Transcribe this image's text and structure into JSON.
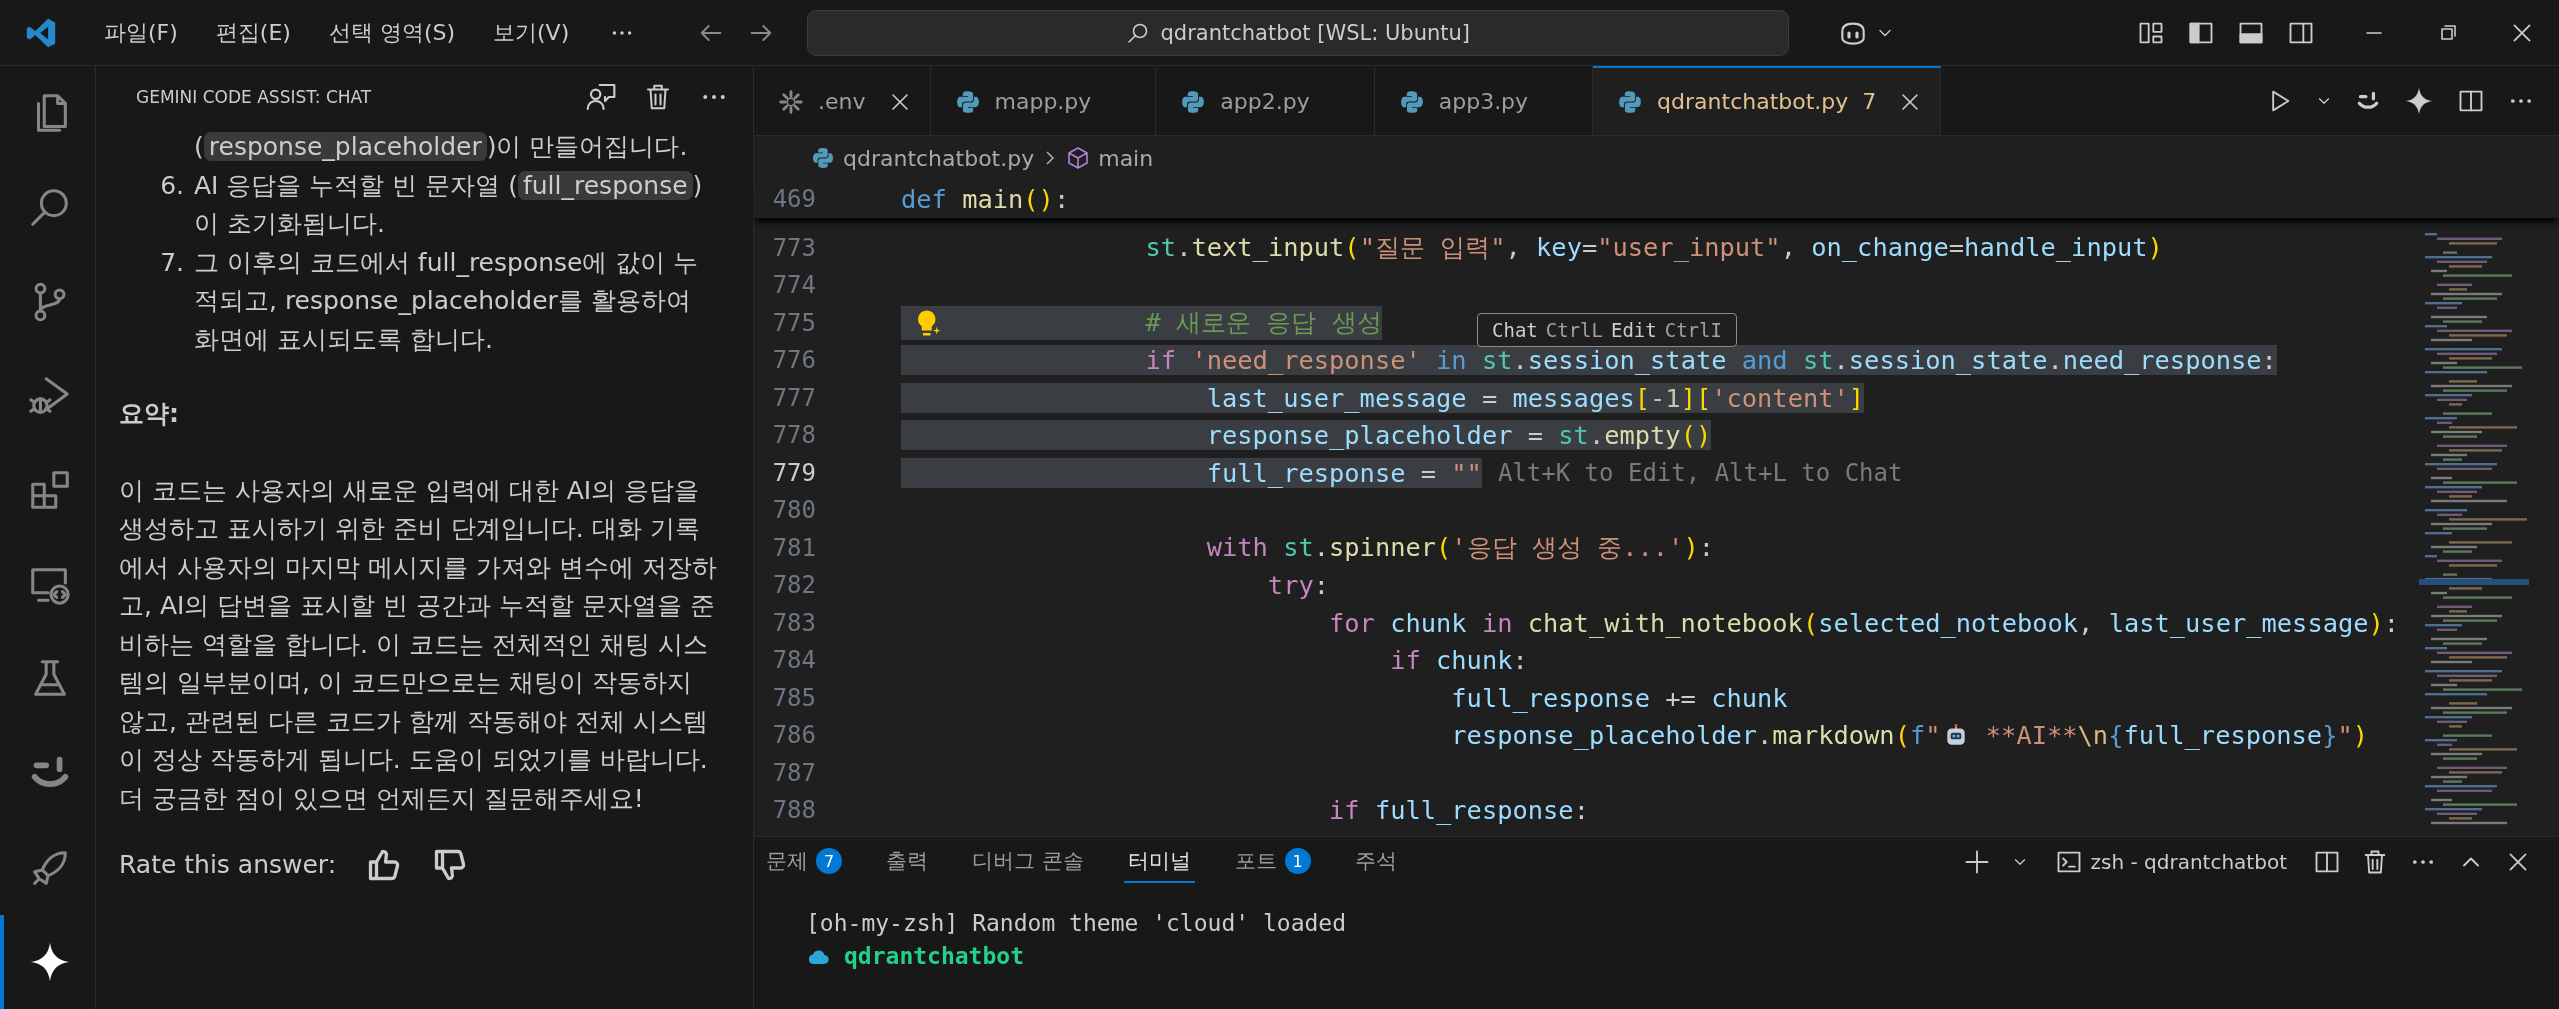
{
  "title_bar": {
    "menus": [
      {
        "label": "파일(F)"
      },
      {
        "label": "편집(E)"
      },
      {
        "label": "선택 영역(S)"
      },
      {
        "label": "보기(V)"
      }
    ],
    "command_center": "qdrantchatbot [WSL: Ubuntu]"
  },
  "activity_bar": [
    {
      "kind": "files",
      "selected": false
    },
    {
      "kind": "search",
      "selected": false
    },
    {
      "kind": "source_control",
      "selected": false
    },
    {
      "kind": "run_debug",
      "selected": false
    },
    {
      "kind": "extensions",
      "selected": false
    },
    {
      "kind": "remote",
      "selected": false
    },
    {
      "kind": "testing",
      "selected": false
    },
    {
      "kind": "smile",
      "selected": false
    },
    {
      "kind": "rocket",
      "selected": false
    },
    {
      "kind": "sparkle",
      "selected": true
    }
  ],
  "side_panel": {
    "title": "GEMINI CODE ASSIST: CHAT",
    "list": [
      {
        "parts": [
          {
            "kind": "text",
            "text": "("
          },
          {
            "kind": "code",
            "text": "response_placeholder"
          },
          {
            "kind": "text",
            "text": ")이 만들어집니다."
          }
        ]
      },
      {
        "number": "6.",
        "parts": [
          {
            "kind": "text",
            "text": "AI 응답을 누적할 빈 문자열 ("
          },
          {
            "kind": "code",
            "text": "full_response"
          },
          {
            "kind": "text",
            "text": ")이 초기화됩니다."
          }
        ]
      },
      {
        "number": "7.",
        "parts": [
          {
            "kind": "text",
            "text": "그 이후의 코드에서 full_response에 값이 누적되고, response_placeholder를 활용하여 화면에 표시되도록 합니다."
          }
        ]
      }
    ],
    "heading": "요약:",
    "paragraph": "이 코드는 사용자의 새로운 입력에 대한 AI의 응답을 생성하고 표시하기 위한 준비 단계입니다. 대화 기록에서 사용자의 마지막 메시지를 가져와 변수에 저장하고, AI의 답변을 표시할 빈 공간과 누적할 문자열을 준비하는 역할을 합니다. 이 코드는 전체적인 채팅 시스템의 일부분이며, 이 코드만으로는 채팅이 작동하지 않고, 관련된 다른 코드가 함께 작동해야 전체 시스템이 정상 작동하게 됩니다. 도움이 되었기를 바랍니다. 더 궁금한 점이 있으면 언제든지 질문해주세요!",
    "rating_label": "Rate this answer:"
  },
  "editor": {
    "tabs": [
      {
        "label": ".env",
        "kind": "config",
        "selected": false,
        "close_shown": true
      },
      {
        "label": "mapp.py",
        "kind": "python",
        "selected": false,
        "close_shown": false
      },
      {
        "label": "app2.py",
        "kind": "python",
        "selected": false,
        "close_shown": false
      },
      {
        "label": "app3.py",
        "kind": "python",
        "selected": false,
        "close_shown": false
      },
      {
        "label": "qdrantchatbot.py",
        "badge": "7",
        "kind": "python",
        "selected": true,
        "close_shown": true
      }
    ],
    "breadcrumb": [
      {
        "label": "qdrantchatbot.py",
        "kind": "file"
      },
      {
        "label": "main",
        "kind": "symbol"
      }
    ],
    "sticky_line": {
      "number": "469",
      "tokens": [
        {
          "kind": "kw",
          "text": "def "
        },
        {
          "kind": "fn",
          "text": "main"
        },
        {
          "kind": "br",
          "text": "()"
        },
        {
          "kind": "plain",
          "text": ":"
        }
      ]
    },
    "lines": [
      {
        "number": "773",
        "selected": false,
        "current": false,
        "tokens": [
          {
            "kind": "cls",
            "text": "                st"
          },
          {
            "kind": "plain",
            "text": "."
          },
          {
            "kind": "fn",
            "text": "text_input"
          },
          {
            "kind": "br",
            "text": "("
          },
          {
            "kind": "str",
            "text": "\"질문 입력\""
          },
          {
            "kind": "plain",
            "text": ", "
          },
          {
            "kind": "var",
            "text": "key"
          },
          {
            "kind": "plain",
            "text": "="
          },
          {
            "kind": "str",
            "text": "\"user_input\""
          },
          {
            "kind": "plain",
            "text": ", "
          },
          {
            "kind": "var",
            "text": "on_change"
          },
          {
            "kind": "plain",
            "text": "="
          },
          {
            "kind": "var",
            "text": "handle_input"
          },
          {
            "kind": "br",
            "text": ")"
          }
        ]
      },
      {
        "number": "774",
        "current": false
      },
      {
        "number": "775",
        "selected": true,
        "current": false,
        "lightbulb": true,
        "tokens": [
          {
            "kind": "comment",
            "text": "                # 새로운 응답 생성"
          }
        ]
      },
      {
        "number": "776",
        "selected": true,
        "current": false,
        "tokens": [
          {
            "kind": "ctrl",
            "text": "                if "
          },
          {
            "kind": "str",
            "text": "'need_response' "
          },
          {
            "kind": "kw",
            "text": "in "
          },
          {
            "kind": "cls",
            "text": "st"
          },
          {
            "kind": "plain",
            "text": "."
          },
          {
            "kind": "var",
            "text": "session_state "
          },
          {
            "kind": "kw",
            "text": "and "
          },
          {
            "kind": "cls",
            "text": "st"
          },
          {
            "kind": "plain",
            "text": "."
          },
          {
            "kind": "var",
            "text": "session_state"
          },
          {
            "kind": "plain",
            "text": "."
          },
          {
            "kind": "var",
            "text": "need_response"
          },
          {
            "kind": "plain",
            "text": ":"
          }
        ]
      },
      {
        "number": "777",
        "selected": true,
        "current": false,
        "tokens": [
          {
            "kind": "var",
            "text": "                    last_user_message"
          },
          {
            "kind": "plain",
            "text": " = "
          },
          {
            "kind": "var",
            "text": "messages"
          },
          {
            "kind": "br",
            "text": "["
          },
          {
            "kind": "num",
            "text": "-1"
          },
          {
            "kind": "br",
            "text": "]["
          },
          {
            "kind": "str",
            "text": "'content'"
          },
          {
            "kind": "br",
            "text": "]"
          }
        ]
      },
      {
        "number": "778",
        "selected": true,
        "current": false,
        "tokens": [
          {
            "kind": "var",
            "text": "                    response_placeholder"
          },
          {
            "kind": "plain",
            "text": " = "
          },
          {
            "kind": "cls",
            "text": "st"
          },
          {
            "kind": "plain",
            "text": "."
          },
          {
            "kind": "fn",
            "text": "empty"
          },
          {
            "kind": "br",
            "text": "()"
          }
        ]
      },
      {
        "number": "779",
        "selected": true,
        "current": true,
        "hint": "Alt+K to Edit, Alt+L to Chat",
        "tokens": [
          {
            "kind": "var",
            "text": "                    full_response"
          },
          {
            "kind": "plain",
            "text": " = "
          },
          {
            "kind": "str",
            "text": "\"\""
          }
        ]
      },
      {
        "number": "780",
        "current": false
      },
      {
        "number": "781",
        "selected": false,
        "current": false,
        "tokens": [
          {
            "kind": "ctrl",
            "text": "                    with "
          },
          {
            "kind": "cls",
            "text": "st"
          },
          {
            "kind": "plain",
            "text": "."
          },
          {
            "kind": "fn",
            "text": "spinner"
          },
          {
            "kind": "br",
            "text": "("
          },
          {
            "kind": "str",
            "text": "'응답 생성 중...'"
          },
          {
            "kind": "br",
            "text": ")"
          },
          {
            "kind": "plain",
            "text": ":"
          }
        ]
      },
      {
        "number": "782",
        "selected": false,
        "current": false,
        "tokens": [
          {
            "kind": "ctrl",
            "text": "                        try"
          },
          {
            "kind": "plain",
            "text": ":"
          }
        ]
      },
      {
        "number": "783",
        "selected": false,
        "current": false,
        "tokens": [
          {
            "kind": "ctrl",
            "text": "                            for "
          },
          {
            "kind": "var",
            "text": "chunk "
          },
          {
            "kind": "ctrl",
            "text": "in "
          },
          {
            "kind": "fn",
            "text": "chat_with_notebook"
          },
          {
            "kind": "br",
            "text": "("
          },
          {
            "kind": "var",
            "text": "selected_notebook"
          },
          {
            "kind": "plain",
            "text": ", "
          },
          {
            "kind": "var",
            "text": "last_user_message"
          },
          {
            "kind": "br",
            "text": ")"
          },
          {
            "kind": "plain",
            "text": ":"
          }
        ]
      },
      {
        "number": "784",
        "selected": false,
        "current": false,
        "tokens": [
          {
            "kind": "ctrl",
            "text": "                                if "
          },
          {
            "kind": "var",
            "text": "chunk"
          },
          {
            "kind": "plain",
            "text": ":"
          }
        ]
      },
      {
        "number": "785",
        "selected": false,
        "current": false,
        "tokens": [
          {
            "kind": "var",
            "text": "                                    full_response"
          },
          {
            "kind": "plain",
            "text": " += "
          },
          {
            "kind": "var",
            "text": "chunk"
          }
        ]
      },
      {
        "number": "786",
        "selected": false,
        "current": false,
        "tokens": [
          {
            "kind": "var",
            "text": "                                    response_placeholder"
          },
          {
            "kind": "plain",
            "text": "."
          },
          {
            "kind": "fn",
            "text": "markdown"
          },
          {
            "kind": "br",
            "text": "("
          },
          {
            "kind": "kw",
            "text": "f"
          },
          {
            "kind": "str",
            "text": "\""
          },
          {
            "kind": "robot"
          },
          {
            "kind": "str",
            "text": " **AI**"
          },
          {
            "kind": "esc",
            "text": "\\n"
          },
          {
            "kind": "kw",
            "text": "{"
          },
          {
            "kind": "var",
            "text": "full_response"
          },
          {
            "kind": "kw",
            "text": "}"
          },
          {
            "kind": "str",
            "text": "\""
          },
          {
            "kind": "br",
            "text": ")"
          }
        ]
      },
      {
        "number": "787",
        "current": false
      },
      {
        "number": "788",
        "selected": false,
        "current": false,
        "tokens": [
          {
            "kind": "ctrl",
            "text": "                            if "
          },
          {
            "kind": "var",
            "text": "full_response"
          },
          {
            "kind": "plain",
            "text": ":"
          }
        ]
      }
    ],
    "hint_widget": [
      {
        "label": "Chat",
        "shortcut": "CtrlL"
      },
      {
        "label": "Edit",
        "shortcut": "CtrlI"
      }
    ]
  },
  "panel": {
    "tabs": [
      {
        "label": "문제",
        "badge": "7",
        "selected": false
      },
      {
        "label": "출력",
        "selected": false
      },
      {
        "label": "디버그 콘솔",
        "selected": false
      },
      {
        "label": "터미널",
        "selected": true
      },
      {
        "label": "포트",
        "badge": "1",
        "selected": false
      },
      {
        "label": "주석",
        "selected": false
      }
    ],
    "terminal_name": "zsh - qdrantchatbot",
    "terminal_lines": [
      {
        "kind": "output",
        "text": "[oh-my-zsh] Random theme 'cloud' loaded"
      },
      {
        "kind": "prompt",
        "text": "qdrantchatbot"
      }
    ]
  }
}
